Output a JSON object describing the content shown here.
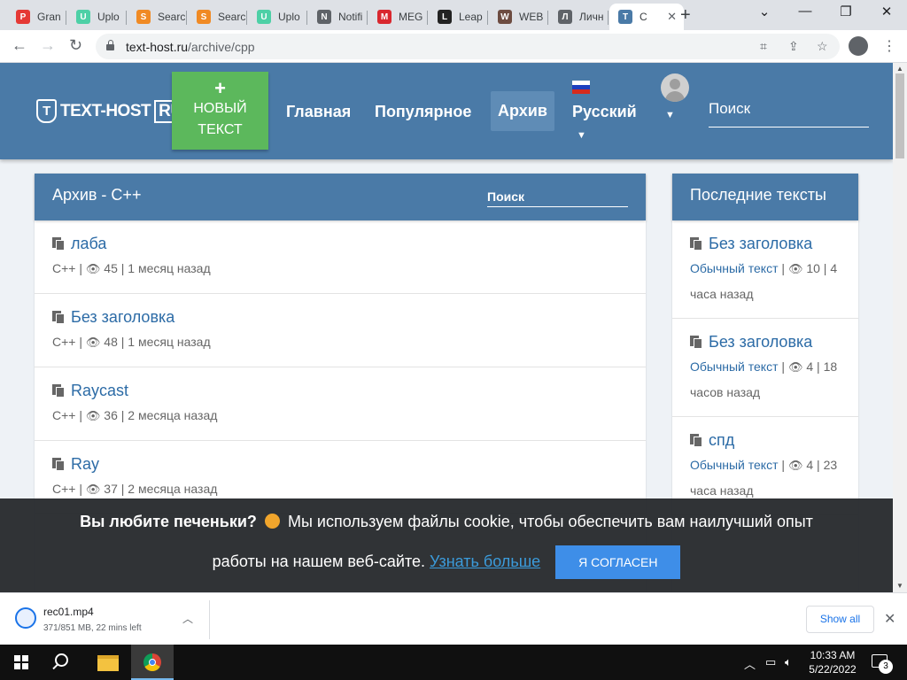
{
  "browser": {
    "tabs": [
      {
        "title": "Gran",
        "color": "#e53935",
        "glyph": "P"
      },
      {
        "title": "Uplo",
        "color": "#4dd0a6",
        "glyph": "U"
      },
      {
        "title": "Searc",
        "color": "#f08a24",
        "glyph": "S"
      },
      {
        "title": "Searc",
        "color": "#f08a24",
        "glyph": "S"
      },
      {
        "title": "Uplo",
        "color": "#4dd0a6",
        "glyph": "U"
      },
      {
        "title": "Notifi",
        "color": "#5f6368",
        "glyph": "N"
      },
      {
        "title": "MEG",
        "color": "#d9272e",
        "glyph": "M"
      },
      {
        "title": "Leap",
        "color": "#222222",
        "glyph": "L"
      },
      {
        "title": "WEB",
        "color": "#6d4c41",
        "glyph": "W"
      },
      {
        "title": "Личн",
        "color": "#5f6368",
        "glyph": "Л"
      },
      {
        "title": "C",
        "color": "#4a7aa7",
        "glyph": "T"
      }
    ],
    "url_host": "text-host.ru",
    "url_path": "/archive/cpp"
  },
  "site": {
    "logo_text": "TEXT-HOST",
    "logo_suffix": "RU",
    "logo_mark": "T",
    "new_text_plus": "+",
    "new_text_label": "НОВЫЙ ТЕКСТ",
    "nav": {
      "home": "Главная",
      "popular": "Популярное",
      "archive": "Архив",
      "language": "Русский"
    },
    "search_placeholder": "Поиск"
  },
  "archive": {
    "title": "Архив - C++",
    "search_placeholder": "Поиск",
    "items": [
      {
        "title": "лаба",
        "lang": "C++",
        "views": "45",
        "ago": "1 месяц назад"
      },
      {
        "title": "Без заголовка",
        "lang": "C++",
        "views": "48",
        "ago": "1 месяц назад"
      },
      {
        "title": "Raycast",
        "lang": "C++",
        "views": "36",
        "ago": "2 месяца назад"
      },
      {
        "title": "Ray",
        "lang": "C++",
        "views": "37",
        "ago": "2 месяца назад"
      }
    ]
  },
  "recent": {
    "title": "Последние тексты",
    "items": [
      {
        "title": "Без заголовка",
        "type": "Обычный текст",
        "views": "10",
        "ago": "4 часа назад"
      },
      {
        "title": "Без заголовка",
        "type": "Обычный текст",
        "views": "4",
        "ago": "18 часов назад"
      },
      {
        "title": "спд",
        "type": "Обычный текст",
        "views": "4",
        "ago": "23 часа назад"
      }
    ]
  },
  "cookie": {
    "question": "Вы любите печеньки?",
    "text1": "Мы используем файлы cookie, чтобы обеспечить вам наилучший опыт",
    "text2": "работы на нашем веб-сайте.",
    "learn_more": "Узнать больше",
    "agree": "Я СОГЛАСЕН"
  },
  "downloads": {
    "filename": "rec01.mp4",
    "status": "371/851 MB, 22 mins left",
    "show_all": "Show all"
  },
  "taskbar": {
    "time": "10:33 AM",
    "date": "5/22/2022",
    "notifications": "3"
  }
}
